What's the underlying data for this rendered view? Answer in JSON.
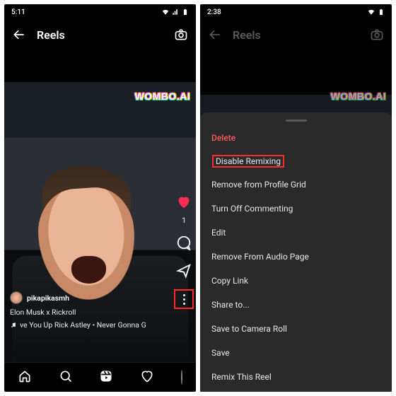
{
  "left": {
    "status_time": "5:11",
    "header_title": "Reels",
    "watermark": "WOMBO.AI",
    "like_count": "1",
    "username": "pikapikasmh",
    "caption": "Elon Musk x Rickroll",
    "audio": "ve You Up   Rick Astley • Never Gonna G"
  },
  "right": {
    "status_time": "2:38",
    "header_title": "Reels",
    "watermark": "WOMBO.AI",
    "menu": {
      "delete": "Delete",
      "disable_remixing": "Disable Remixing",
      "remove_grid": "Remove from Profile Grid",
      "turn_off_commenting": "Turn Off Commenting",
      "edit": "Edit",
      "remove_audio": "Remove From Audio Page",
      "copy_link": "Copy Link",
      "share_to": "Share to...",
      "save_camera_roll": "Save to Camera Roll",
      "save": "Save",
      "remix": "Remix This Reel"
    }
  }
}
